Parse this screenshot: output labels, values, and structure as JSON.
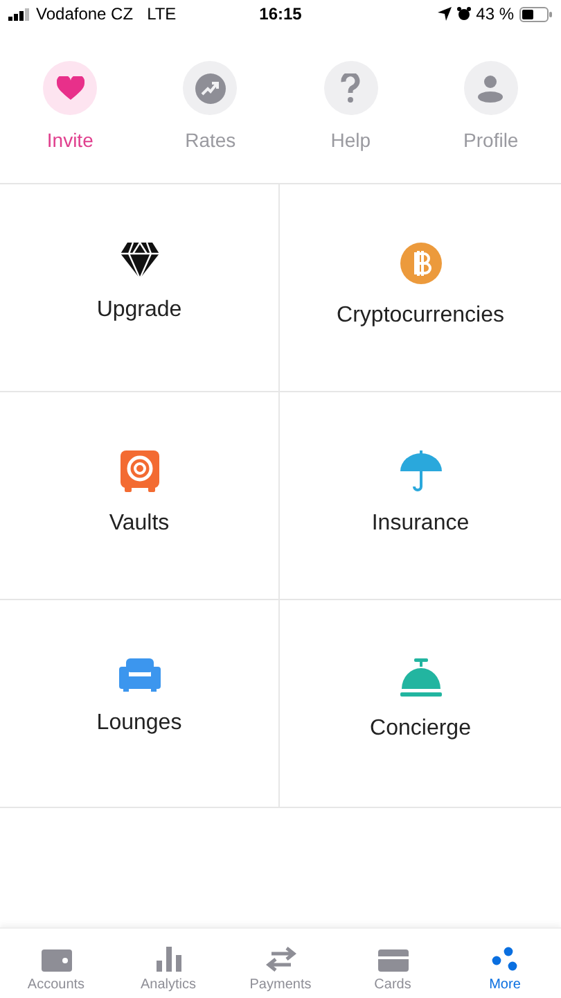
{
  "status_bar": {
    "carrier": "Vodafone CZ",
    "network": "LTE",
    "time": "16:15",
    "battery": "43 %"
  },
  "quick_actions": [
    {
      "label": "Invite",
      "selected": true
    },
    {
      "label": "Rates",
      "selected": false
    },
    {
      "label": "Help",
      "selected": false
    },
    {
      "label": "Profile",
      "selected": false
    }
  ],
  "tiles": [
    {
      "label": "Upgrade"
    },
    {
      "label": "Cryptocurrencies"
    },
    {
      "label": "Vaults"
    },
    {
      "label": "Insurance"
    },
    {
      "label": "Lounges"
    },
    {
      "label": "Concierge"
    }
  ],
  "tab_bar": [
    {
      "label": "Accounts",
      "selected": false
    },
    {
      "label": "Analytics",
      "selected": false
    },
    {
      "label": "Payments",
      "selected": false
    },
    {
      "label": "Cards",
      "selected": false
    },
    {
      "label": "More",
      "selected": true
    }
  ]
}
